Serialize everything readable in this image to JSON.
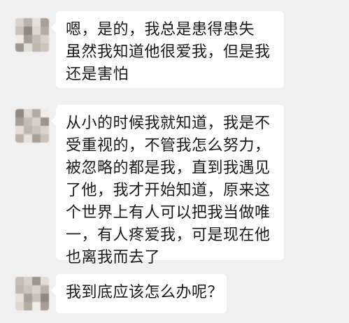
{
  "messages": [
    {
      "sender": "other",
      "lines": [
        "嗯，是的，我总是患得患失",
        "虽然我知道他很爱我，但是我",
        "还是害怕"
      ]
    },
    {
      "sender": "other",
      "lines": [
        "从小的时候我就知道，我是不",
        "受重视的，不管我怎么努力，",
        "被忽略的都是我，直到我遇见",
        "了他，我才开始知道，原来这",
        "个世界上有人可以把我当做唯",
        "一，有人疼爱我，可是现在他",
        "也离我而去了"
      ]
    },
    {
      "sender": "other",
      "lines": [
        "我到底应该怎么办呢？"
      ]
    }
  ],
  "avatar_colors": [
    "#d8d2cc",
    "#b9b1aa",
    "#e6e1dc",
    "#a79f98",
    "#c9c2bb",
    "#8f8882",
    "#ddd7d1",
    "#b3aca5",
    "#efebe7",
    "#a49c95",
    "#c4bdb6",
    "#d6d0ca",
    "#9c948d",
    "#e2ddd8",
    "#beb7b0",
    "#cbc4bd"
  ]
}
